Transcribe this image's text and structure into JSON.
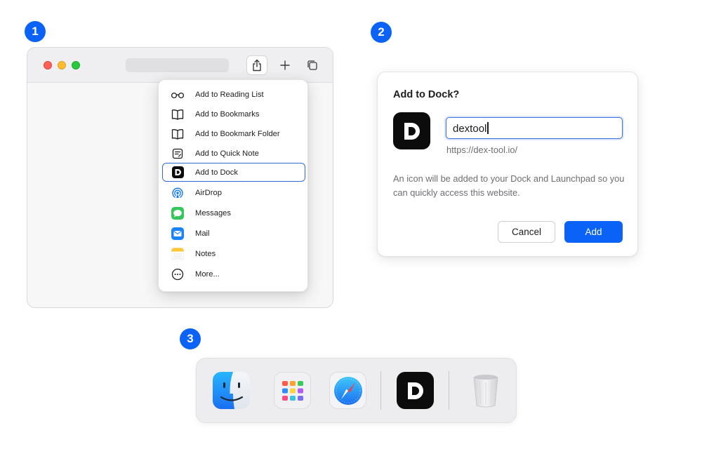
{
  "steps": {
    "one": "1",
    "two": "2",
    "three": "3"
  },
  "share_menu": {
    "items": [
      {
        "label": "Add to Reading List",
        "icon": "glasses-icon"
      },
      {
        "label": "Add to Bookmarks",
        "icon": "book-icon"
      },
      {
        "label": "Add to Bookmark Folder",
        "icon": "book-icon"
      },
      {
        "label": "Add to Quick Note",
        "icon": "quick-note-icon"
      },
      {
        "label": "Add to Dock",
        "icon": "dextool-icon",
        "selected": true
      },
      {
        "label": "AirDrop",
        "icon": "airdrop-icon"
      },
      {
        "label": "Messages",
        "icon": "messages-icon"
      },
      {
        "label": "Mail",
        "icon": "mail-icon"
      },
      {
        "label": "Notes",
        "icon": "notes-icon"
      },
      {
        "label": "More...",
        "icon": "more-icon"
      }
    ]
  },
  "dialog": {
    "title": "Add to Dock?",
    "name_value": "dextool",
    "url": "https://dex-tool.io/",
    "description": "An icon will be added to your Dock and Launchpad so you can quickly access this website.",
    "cancel_label": "Cancel",
    "add_label": "Add"
  },
  "dock": {
    "apps": [
      "finder-icon",
      "launchpad-icon",
      "safari-icon",
      "dextool-icon",
      "trash-icon"
    ]
  },
  "colors": {
    "accent": "#0a63f6",
    "selection_border": "#2e6ad6",
    "traffic_red": "#ff5f57",
    "traffic_yellow": "#febc2e",
    "traffic_green": "#28c840"
  }
}
